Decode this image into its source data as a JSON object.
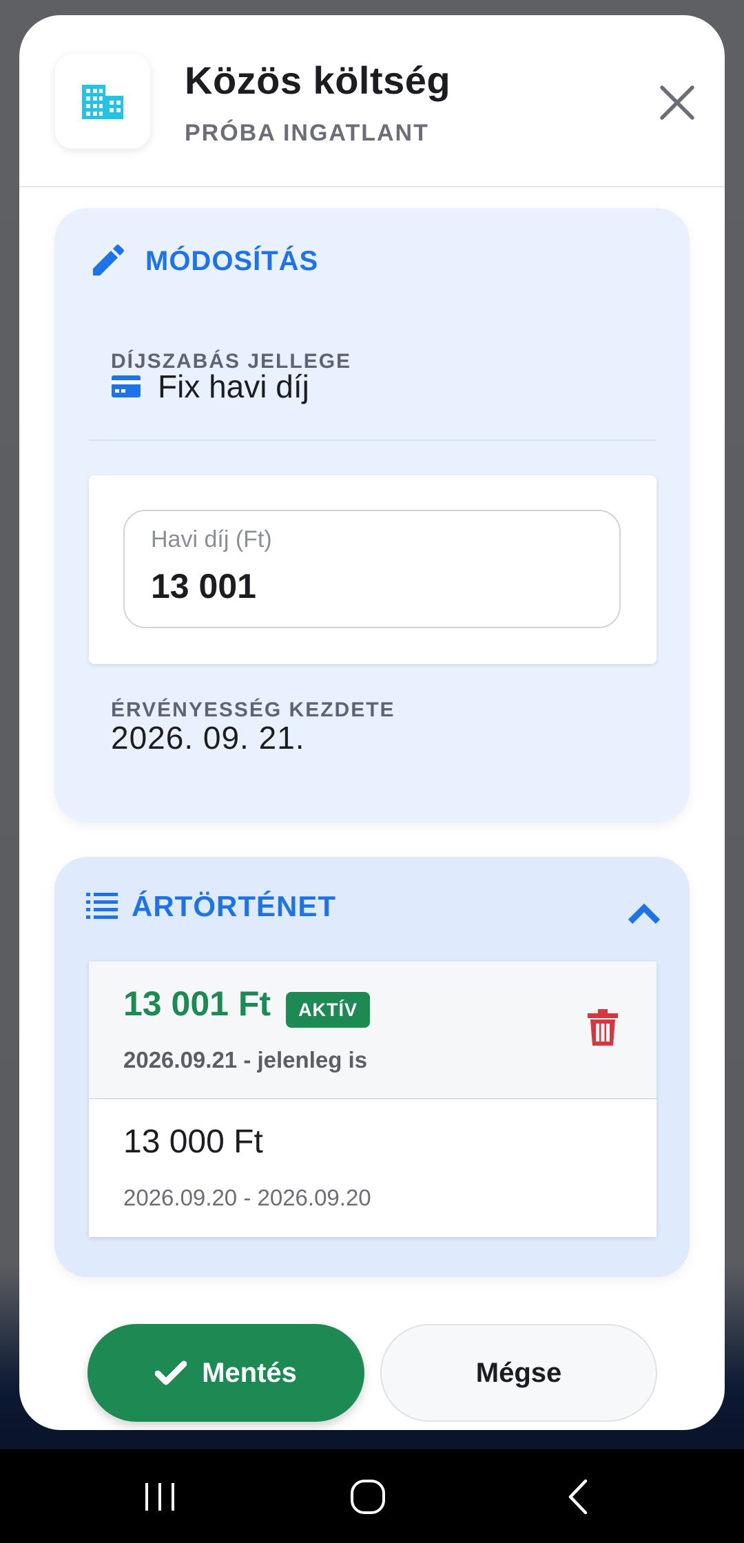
{
  "header": {
    "title": "Közös költség",
    "subtitle": "PRÓBA INGATLANT",
    "app_icon": "building-icon",
    "close_icon": "close-icon"
  },
  "edit_section": {
    "title": "MÓDOSÍTÁS",
    "icon": "pencil-icon",
    "pricing_label": "DÍJSZABÁS JELLEGE",
    "pricing_value": "Fix havi díj",
    "pricing_icon": "card-icon",
    "monthly_fee": {
      "label": "Havi díj (Ft)",
      "value": "13 001"
    },
    "validity_label": "ÉRVÉNYESSÉG KEZDETE",
    "validity_value": "2026. 09. 21."
  },
  "history_section": {
    "title": "ÁRTÖRTÉNET",
    "icon": "list-icon",
    "expanded": true,
    "entries": [
      {
        "amount": "13 001 Ft",
        "badge": "AKTÍV",
        "range": "2026.09.21 - jelenleg is",
        "active": true
      },
      {
        "amount": "13 000 Ft",
        "range": "2026.09.20 - 2026.09.20",
        "active": false
      }
    ]
  },
  "actions": {
    "save_label": "Mentés",
    "cancel_label": "Mégse"
  },
  "colors": {
    "accent_blue": "#1e73e8",
    "success_green": "#1c8a52",
    "danger_red": "#d9363e",
    "icon_cyan": "#22c3e6"
  }
}
